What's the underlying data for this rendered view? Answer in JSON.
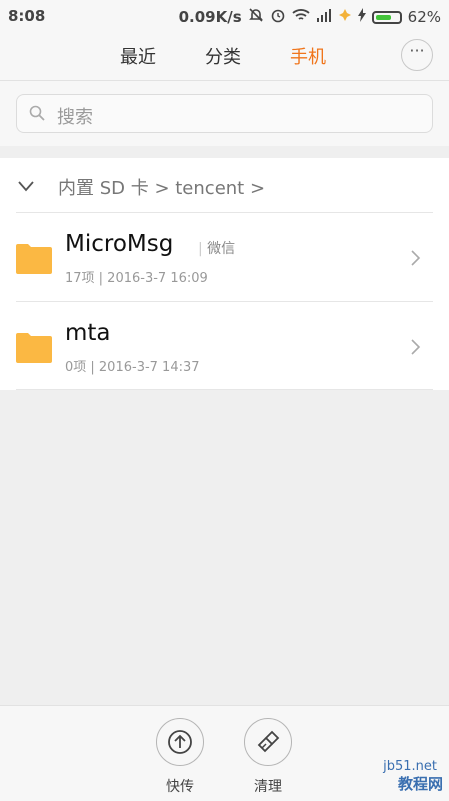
{
  "status_bar": {
    "time": "8:08",
    "net_speed": "0.09K/s",
    "battery_percent": "62%",
    "icons": [
      "mute-bell-icon",
      "alarm-icon",
      "wifi-icon",
      "signal-icon",
      "app-icon",
      "charging-icon",
      "battery-icon"
    ]
  },
  "nav": {
    "tabs": [
      {
        "label": "最近",
        "active": false
      },
      {
        "label": "分类",
        "active": false
      },
      {
        "label": "手机",
        "active": true
      }
    ],
    "more_label": "···",
    "accent_color": "#f0751b"
  },
  "search": {
    "placeholder": "搜索"
  },
  "breadcrumb": {
    "path": "内置 SD 卡 > tencent >"
  },
  "files": [
    {
      "name": "MicroMsg",
      "tag": "微信",
      "meta": "17项 | 2016-3-7 16:09"
    },
    {
      "name": "mta",
      "tag": "",
      "meta": "0项 | 2016-3-7 14:37"
    }
  ],
  "bottom_actions": [
    {
      "label": "快传",
      "icon": "upload-icon"
    },
    {
      "label": "清理",
      "icon": "brush-icon"
    }
  ],
  "watermark": {
    "line1": "jb51.net",
    "line2": "教程网"
  }
}
